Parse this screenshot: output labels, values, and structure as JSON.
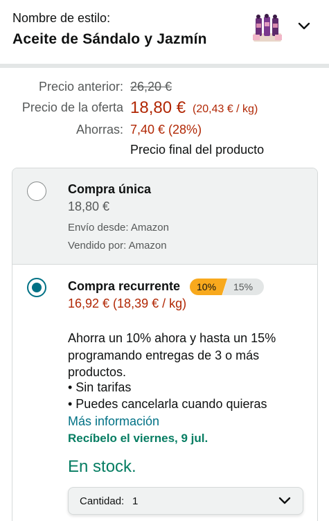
{
  "style_selector": {
    "label": "Nombre de estilo:",
    "value": "Aceite de Sándalo y Jazmín",
    "thumbnail_icon": "product-thumbnail",
    "chevron_icon": "chevron-down-icon"
  },
  "pricing": {
    "previous_label": "Precio anterior:",
    "previous_price": "26,20 €",
    "deal_label": "Precio de la oferta",
    "deal_price": "18,80 €",
    "deal_unit_price": "(20,43 € / kg)",
    "savings_label": "Ahorras:",
    "savings_value": "7,40 € (28%)",
    "final_note": "Precio final del producto"
  },
  "purchase_options": {
    "one_time": {
      "title": "Compra única",
      "price": "18,80 €",
      "shipping": "Envío desde: Amazon",
      "sold_by": "Vendido por: Amazon",
      "selected": false
    },
    "subscribe": {
      "title": "Compra recurrente",
      "badge_now": "10%",
      "badge_max": "15%",
      "price": "16,92 € (18,39 € / kg)",
      "description": "Ahorra un 10% ahora y hasta un 15% programando entregas de 3 o más productos.",
      "bullet_1": "• Sin tarifas",
      "bullet_2": "• Puedes cancelarla cuando quieras",
      "more_info": "Más información",
      "delivery": "Recíbelo el viernes, 9 jul.",
      "stock": "En stock.",
      "selected": true
    }
  },
  "quantity": {
    "label": "Cantidad:",
    "value": "1"
  },
  "colors": {
    "price_red": "#b12704",
    "link_teal": "#007185",
    "stock_green": "#067d62",
    "badge_orange": "#f8a91d"
  }
}
